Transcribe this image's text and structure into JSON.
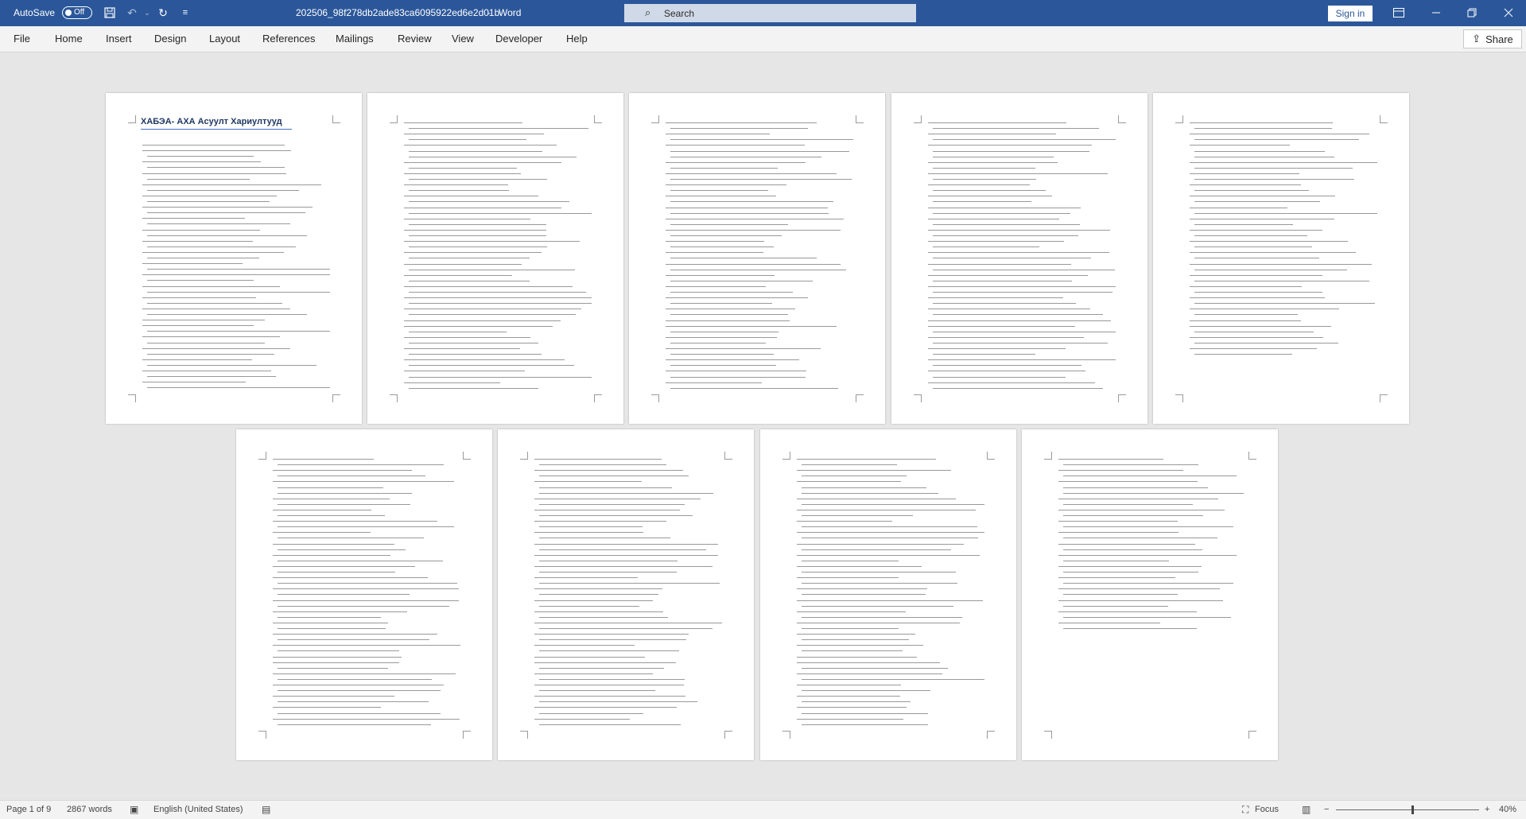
{
  "titlebar": {
    "autosave_label": "AutoSave",
    "autosave_state": "Off",
    "doc_name": "202506_98f278db2ade83ca6095922ed6e2d01b",
    "separator": "-",
    "app_name": "Word",
    "search_placeholder": "Search",
    "signin": "Sign in",
    "bg_color": "#2b579a"
  },
  "ribbon": {
    "tabs": [
      "File",
      "Home",
      "Insert",
      "Design",
      "Layout",
      "References",
      "Mailings",
      "Review",
      "View",
      "Developer",
      "Help"
    ],
    "share": "Share"
  },
  "document": {
    "title": "ХАБЭА- АХА Асуулт Хариултууд",
    "page_count": 9
  },
  "statusbar": {
    "page": "Page 1 of 9",
    "words": "2867 words",
    "language": "English (United States)",
    "focus": "Focus",
    "zoom": "40%",
    "zoom_minus": "−",
    "zoom_plus": "+"
  }
}
